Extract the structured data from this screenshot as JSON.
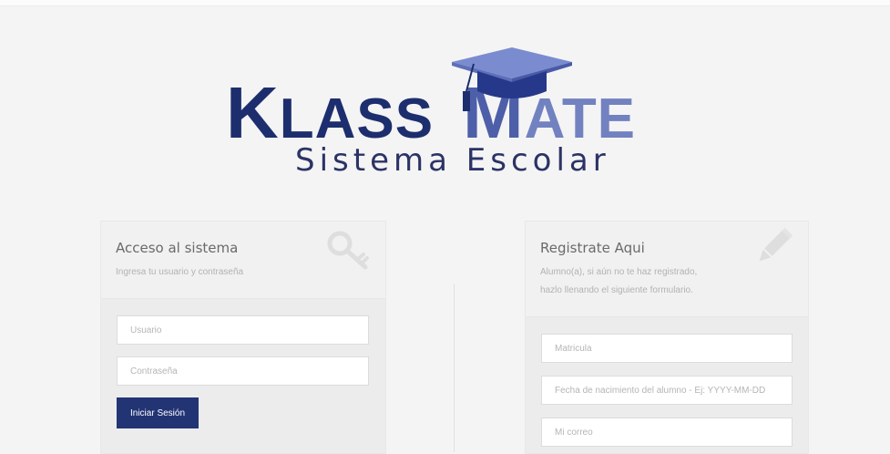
{
  "logo": {
    "klass_first": "K",
    "klass_rest": "LASS",
    "mate_first": "M",
    "mate_rest": "ATE",
    "subtitle": "Sistema Escolar",
    "colors": {
      "dark": "#1d2e6e",
      "light": "#4d5fa8",
      "lighter": "#7281c0",
      "cap": "#6d7fc6"
    }
  },
  "login": {
    "title": "Acceso al sistema",
    "description": "Ingresa tu usuario y contraseña",
    "icon": "key-icon",
    "user_placeholder": "Usuario",
    "password_placeholder": "Contraseña",
    "submit_label": "Iniciar Sesión"
  },
  "register": {
    "title": "Registrate Aqui",
    "description_line1": "Alumno(a), si aún no te haz registrado,",
    "description_line2": "hazlo llenando el siguiente formulario.",
    "icon": "pencil-icon",
    "matricula_placeholder": "Matricula",
    "birthdate_placeholder": "Fecha de nacimiento del alumno - Ej: YYYY-MM-DD",
    "email_placeholder": "Mi correo"
  },
  "colors": {
    "button": "#223474",
    "panel_bg": "#ececec",
    "page_bg": "#f4f4f4"
  }
}
